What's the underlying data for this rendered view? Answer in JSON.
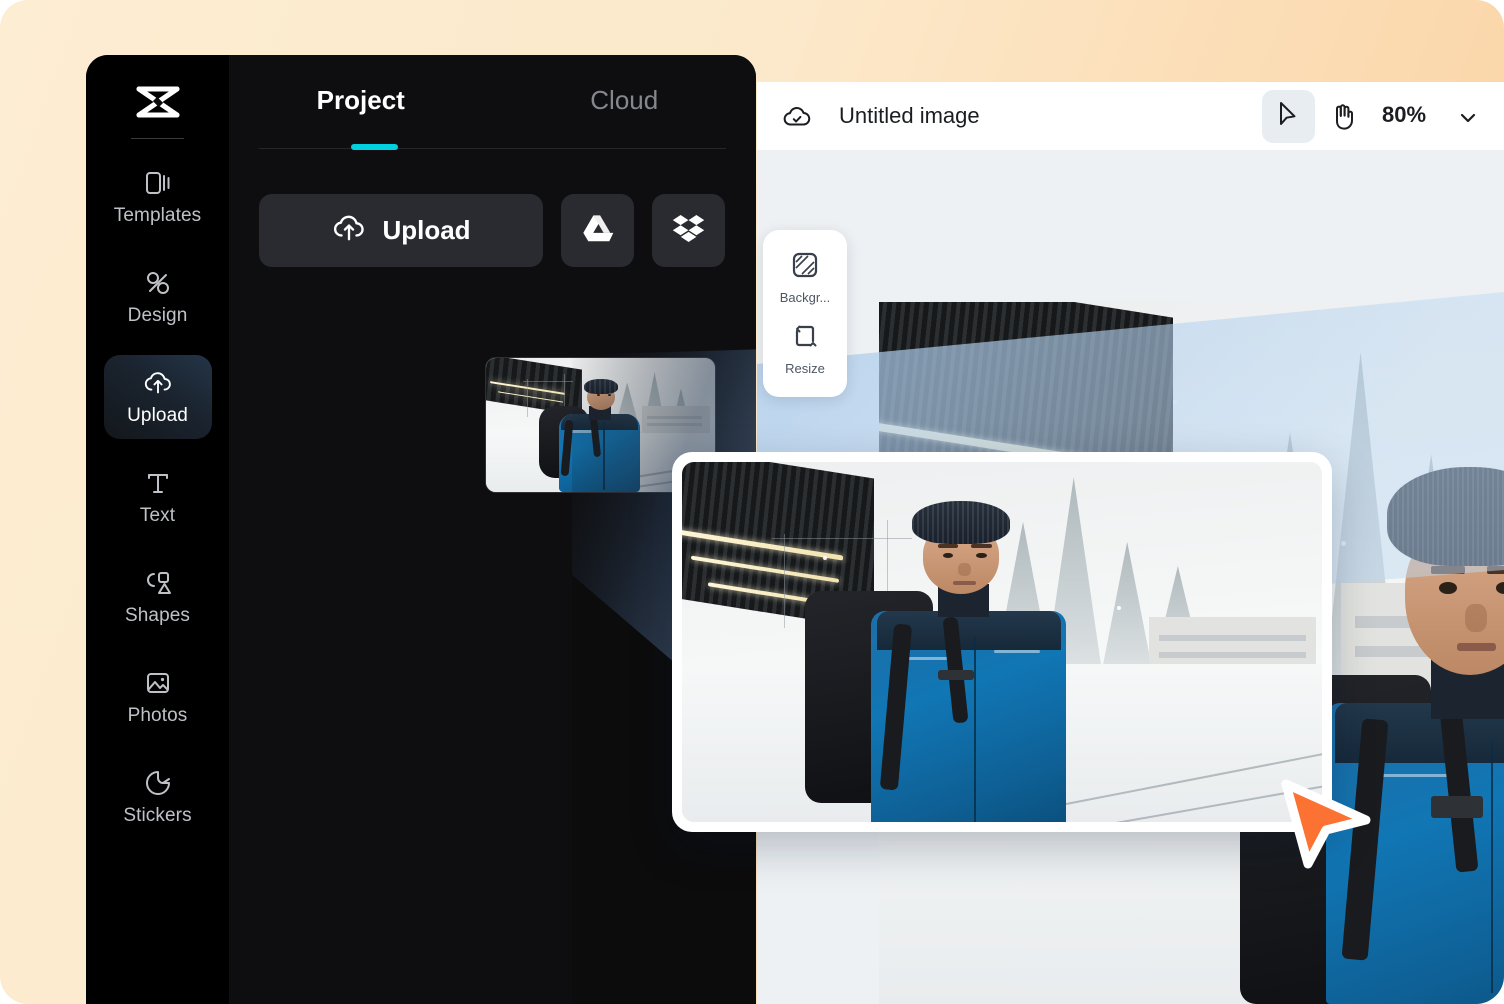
{
  "app": {
    "logo_icon": "capcut-logo-icon"
  },
  "sidebar": {
    "items": [
      {
        "label": "Templates",
        "icon": "templates-icon",
        "active": false
      },
      {
        "label": "Design",
        "icon": "design-icon",
        "active": false
      },
      {
        "label": "Upload",
        "icon": "upload-cloud-icon",
        "active": true
      },
      {
        "label": "Text",
        "icon": "text-icon",
        "active": false
      },
      {
        "label": "Shapes",
        "icon": "shapes-icon",
        "active": false
      },
      {
        "label": "Photos",
        "icon": "photos-icon",
        "active": false
      },
      {
        "label": "Stickers",
        "icon": "stickers-icon",
        "active": false
      }
    ]
  },
  "panel": {
    "tabs": [
      {
        "label": "Project",
        "selected": true
      },
      {
        "label": "Cloud",
        "selected": false
      }
    ],
    "underline_color": "#00D1E0",
    "upload_button": {
      "label": "Upload",
      "icon": "upload-cloud-icon"
    },
    "google_drive_button": {
      "icon": "google-drive-icon"
    },
    "dropbox_button": {
      "icon": "dropbox-icon"
    },
    "media_items": [
      {
        "name": "snow-station-photo-thumbnail"
      }
    ]
  },
  "canvas": {
    "topbar": {
      "cloud_status_icon": "cloud-check-icon",
      "document_title": "Untitled image",
      "select_tool_icon": "cursor-arrow-icon",
      "hand_tool_icon": "hand-icon",
      "zoom_level": "80%",
      "zoom_caret_icon": "chevron-down-icon"
    },
    "tool_dock": [
      {
        "label": "Backgr...",
        "icon": "background-icon"
      },
      {
        "label": "Resize",
        "icon": "resize-icon"
      }
    ],
    "artboard": {
      "name": "snow-station-photo"
    }
  },
  "drag": {
    "preview_card": {
      "name": "snow-station-photo-preview"
    },
    "cursor": {
      "icon": "orange-arrow-cursor-icon",
      "color": "#FB7233"
    }
  },
  "colors": {
    "backdrop_light": "#FDEDD2",
    "backdrop_dark": "#F9CE9B",
    "shell_bg": "#0C0C0E",
    "rail_bg": "#000000",
    "panel_bg": "#0E0E10",
    "accent_cyan": "#00D1E0",
    "canvas_bg": "#EDF1F4",
    "cursor_orange": "#FB7233"
  }
}
